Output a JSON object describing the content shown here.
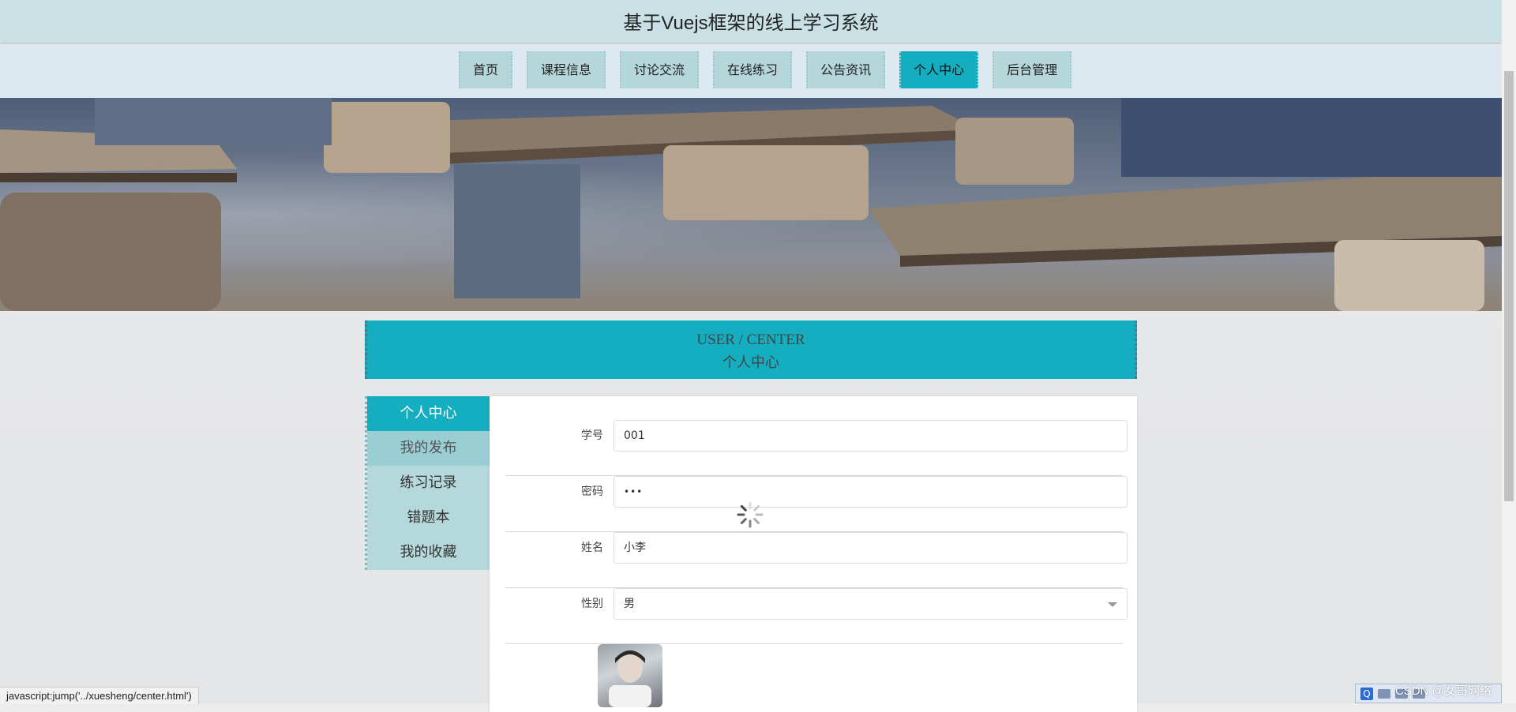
{
  "site": {
    "title": "基于Vuejs框架的线上学习系统"
  },
  "nav": {
    "items": [
      {
        "label": "首页"
      },
      {
        "label": "课程信息"
      },
      {
        "label": "讨论交流"
      },
      {
        "label": "在线练习"
      },
      {
        "label": "公告资讯"
      },
      {
        "label": "个人中心"
      },
      {
        "label": "后台管理"
      }
    ],
    "active": "个人中心"
  },
  "center": {
    "title_en": "USER / CENTER",
    "title_zh": "个人中心"
  },
  "side_menu": {
    "items": [
      {
        "label": "个人中心"
      },
      {
        "label": "我的发布"
      },
      {
        "label": "练习记录"
      },
      {
        "label": "错题本"
      },
      {
        "label": "我的收藏"
      }
    ],
    "active": "个人中心",
    "hover": "我的发布"
  },
  "form": {
    "student_id": {
      "label": "学号",
      "value": "001"
    },
    "password": {
      "label": "密码",
      "value": "•••"
    },
    "name": {
      "label": "姓名",
      "value": "小李"
    },
    "gender": {
      "label": "性别",
      "value": "男"
    }
  },
  "status_bar": {
    "text": "javascript:jump('../xuesheng/center.html')"
  },
  "watermark": {
    "text": "CSDN @女哥网络"
  },
  "tray": {
    "logo": "Q"
  },
  "colors": {
    "accent": "#14aec0",
    "nav_bg": "#b5d7da",
    "header_bg": "#c9e1e4"
  }
}
